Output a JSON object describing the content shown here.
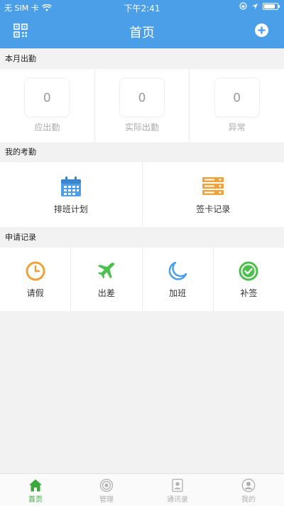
{
  "status_bar": {
    "carrier": "无 SIM 卡",
    "time": "下午2:41",
    "battery_level": 0.85
  },
  "nav": {
    "title": "首页",
    "left_icon": "qr-code-icon",
    "right_icon": "add-circle-icon"
  },
  "sections": {
    "this_month": "本月出勤",
    "my_attendance": "我的考勤",
    "requests": "申请记录"
  },
  "attendance": [
    {
      "value": "0",
      "label": "应出勤"
    },
    {
      "value": "0",
      "label": "实际出勤"
    },
    {
      "value": "0",
      "label": "异常"
    }
  ],
  "my_attendance": [
    {
      "label": "排班计划",
      "icon": "calendar-icon",
      "color": "#4a9fe8"
    },
    {
      "label": "签卡记录",
      "icon": "records-icon",
      "color": "#f0a23a"
    }
  ],
  "requests": [
    {
      "label": "请假",
      "icon": "clock-icon",
      "color": "#f0a23a"
    },
    {
      "label": "出差",
      "icon": "airplane-icon",
      "color": "#4cc04c"
    },
    {
      "label": "加班",
      "icon": "moon-icon",
      "color": "#4a9fe8"
    },
    {
      "label": "补签",
      "icon": "check-circle-icon",
      "color": "#4cc04c"
    }
  ],
  "tabbar": {
    "active": 0,
    "items": [
      {
        "label": "首页",
        "icon": "home-icon"
      },
      {
        "label": "管理",
        "icon": "manage-icon"
      },
      {
        "label": "通讯录",
        "icon": "contacts-icon"
      },
      {
        "label": "我的",
        "icon": "profile-icon"
      }
    ]
  },
  "colors": {
    "primary": "#4a9fe8",
    "active_tab": "#3aa83a",
    "background": "#f2f2f2"
  }
}
